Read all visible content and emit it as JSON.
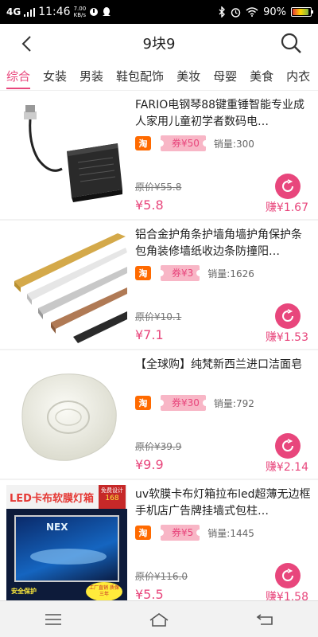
{
  "status": {
    "network": "4G",
    "time": "11:46",
    "speed_value": "7.00",
    "speed_unit": "KB/s",
    "battery": "90%",
    "battery_level": 0.9
  },
  "header": {
    "title": "9块9"
  },
  "tabs": [
    {
      "label": "综合",
      "active": true
    },
    {
      "label": "女装"
    },
    {
      "label": "男装"
    },
    {
      "label": "鞋包配饰"
    },
    {
      "label": "美妆"
    },
    {
      "label": "母婴"
    },
    {
      "label": "美食"
    },
    {
      "label": "内衣"
    }
  ],
  "products": [
    {
      "title": "FARIO电钢琴88键重锤智能专业成人家用儿童初学者数码电…",
      "platform": "淘",
      "coupon": "券¥50",
      "sales": "销量:300",
      "original_price": "原价¥55.8",
      "price": "¥5.8",
      "earn": "赚¥1.67"
    },
    {
      "title": "铝合金护角条护墙角墙护角保护条包角装修墙纸收边条防撞阳…",
      "platform": "淘",
      "coupon": "券¥3",
      "sales": "销量:1626",
      "original_price": "原价¥10.1",
      "price": "¥7.1",
      "earn": "赚¥1.53"
    },
    {
      "title": "【全球购】纯梵新西兰进口洁面皂",
      "platform": "淘",
      "coupon": "券¥30",
      "sales": "销量:792",
      "original_price": "原价¥39.9",
      "price": "¥9.9",
      "earn": "赚¥2.14"
    },
    {
      "title": "uv软膜卡布灯箱拉布led超薄无边框手机店广告牌挂墙式包柱…",
      "platform": "淘",
      "coupon": "券¥5",
      "sales": "销量:1445",
      "original_price": "原价¥116.0",
      "price": "¥5.5",
      "earn": "赚¥1.58",
      "image_text": {
        "headline": "LED卡布软膜灯箱",
        "badge_top": "免费设计",
        "badge_price": "168",
        "screen_text": "NEX",
        "footer_left": "安全保护",
        "footer_right": "工厂直销 质保三年"
      }
    }
  ],
  "colors": {
    "accent": "#e8467c",
    "coupon_bg": "#f8b6c6",
    "taobao": "#ff6a00"
  }
}
